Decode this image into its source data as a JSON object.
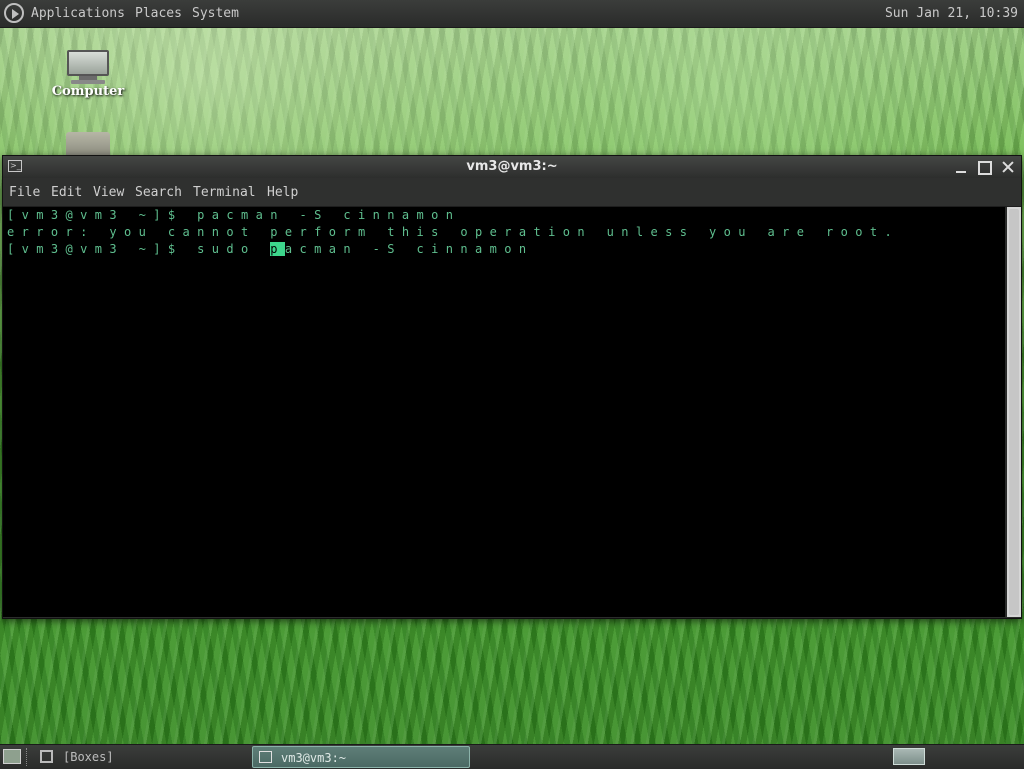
{
  "top_panel": {
    "menus": [
      "Applications",
      "Places",
      "System"
    ],
    "clock": "Sun Jan 21, 10:39"
  },
  "desktop": {
    "icons": [
      {
        "label": "Computer",
        "icon": "computer-icon"
      },
      {
        "label": "",
        "icon": "folder-icon"
      }
    ]
  },
  "window": {
    "title": "vm3@vm3:~",
    "menu": [
      "File",
      "Edit",
      "View",
      "Search",
      "Terminal",
      "Help"
    ],
    "terminal": {
      "lines": [
        "[vm3@vm3 ~]$ pacman -S cinnamon",
        "error: you cannot perform this operation unless you are root."
      ],
      "current_prompt": "[vm3@vm3 ~]$ sudo ",
      "cursor_char": "p",
      "current_rest": "acman -S cinnamon"
    }
  },
  "bottom_panel": {
    "workspace_label": "[Boxes]",
    "task_label": "vm3@vm3:~"
  },
  "colors": {
    "terminal_fg": "#5fbf8f",
    "cursor": "#3dd68c",
    "panel": "#2f302f"
  }
}
